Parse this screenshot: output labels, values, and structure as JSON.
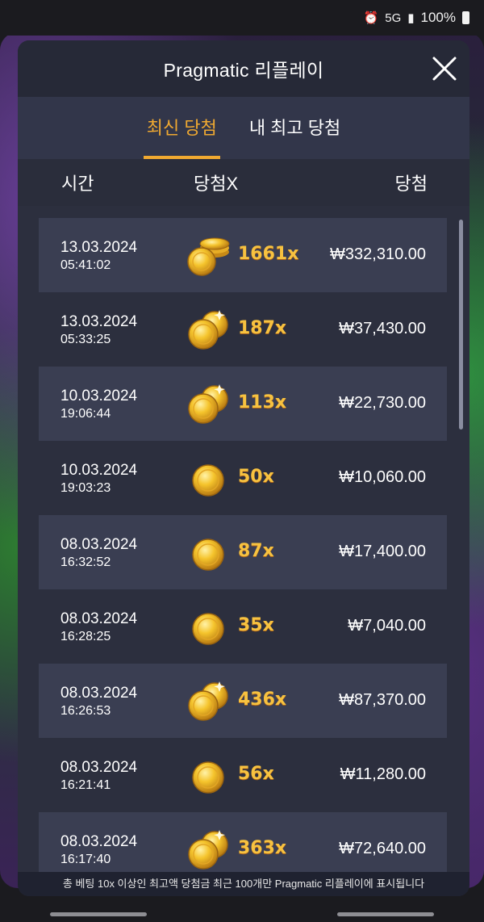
{
  "status_bar": {
    "battery_text": "100%",
    "network": "5G"
  },
  "modal": {
    "title": "Pragmatic 리플레이",
    "tabs": [
      {
        "label": "최신 당첨",
        "active": true
      },
      {
        "label": "내 최고 당첨",
        "active": false
      }
    ],
    "columns": {
      "time": "시간",
      "multiplier": "당첨X",
      "win": "당첨"
    },
    "rows": [
      {
        "date": "13.03.2024",
        "time": "05:41:02",
        "multiplier": "1661x",
        "win": "₩332,310.00",
        "coin_icon": "coin-stack-icon"
      },
      {
        "date": "13.03.2024",
        "time": "05:33:25",
        "multiplier": "187x",
        "win": "₩37,430.00",
        "coin_icon": "coin-pair-icon"
      },
      {
        "date": "10.03.2024",
        "time": "19:06:44",
        "multiplier": "113x",
        "win": "₩22,730.00",
        "coin_icon": "coin-pair-icon"
      },
      {
        "date": "10.03.2024",
        "time": "19:03:23",
        "multiplier": "50x",
        "win": "₩10,060.00",
        "coin_icon": "coin-icon"
      },
      {
        "date": "08.03.2024",
        "time": "16:32:52",
        "multiplier": "87x",
        "win": "₩17,400.00",
        "coin_icon": "coin-icon"
      },
      {
        "date": "08.03.2024",
        "time": "16:28:25",
        "multiplier": "35x",
        "win": "₩7,040.00",
        "coin_icon": "coin-icon"
      },
      {
        "date": "08.03.2024",
        "time": "16:26:53",
        "multiplier": "436x",
        "win": "₩87,370.00",
        "coin_icon": "coin-pair-icon"
      },
      {
        "date": "08.03.2024",
        "time": "16:21:41",
        "multiplier": "56x",
        "win": "₩11,280.00",
        "coin_icon": "coin-icon"
      },
      {
        "date": "08.03.2024",
        "time": "16:17:40",
        "multiplier": "363x",
        "win": "₩72,640.00",
        "coin_icon": "coin-pair-icon"
      }
    ],
    "footer_note": "총 베팅 10x 이상인 최고액 당첨금 최근 100개만 Pragmatic 리플레이에 표시됩니다"
  },
  "colors": {
    "accent": "#f0a931",
    "multiplier": "#f7c240",
    "panel": "#2c2f3e",
    "row_alt": "#3a3e52"
  }
}
